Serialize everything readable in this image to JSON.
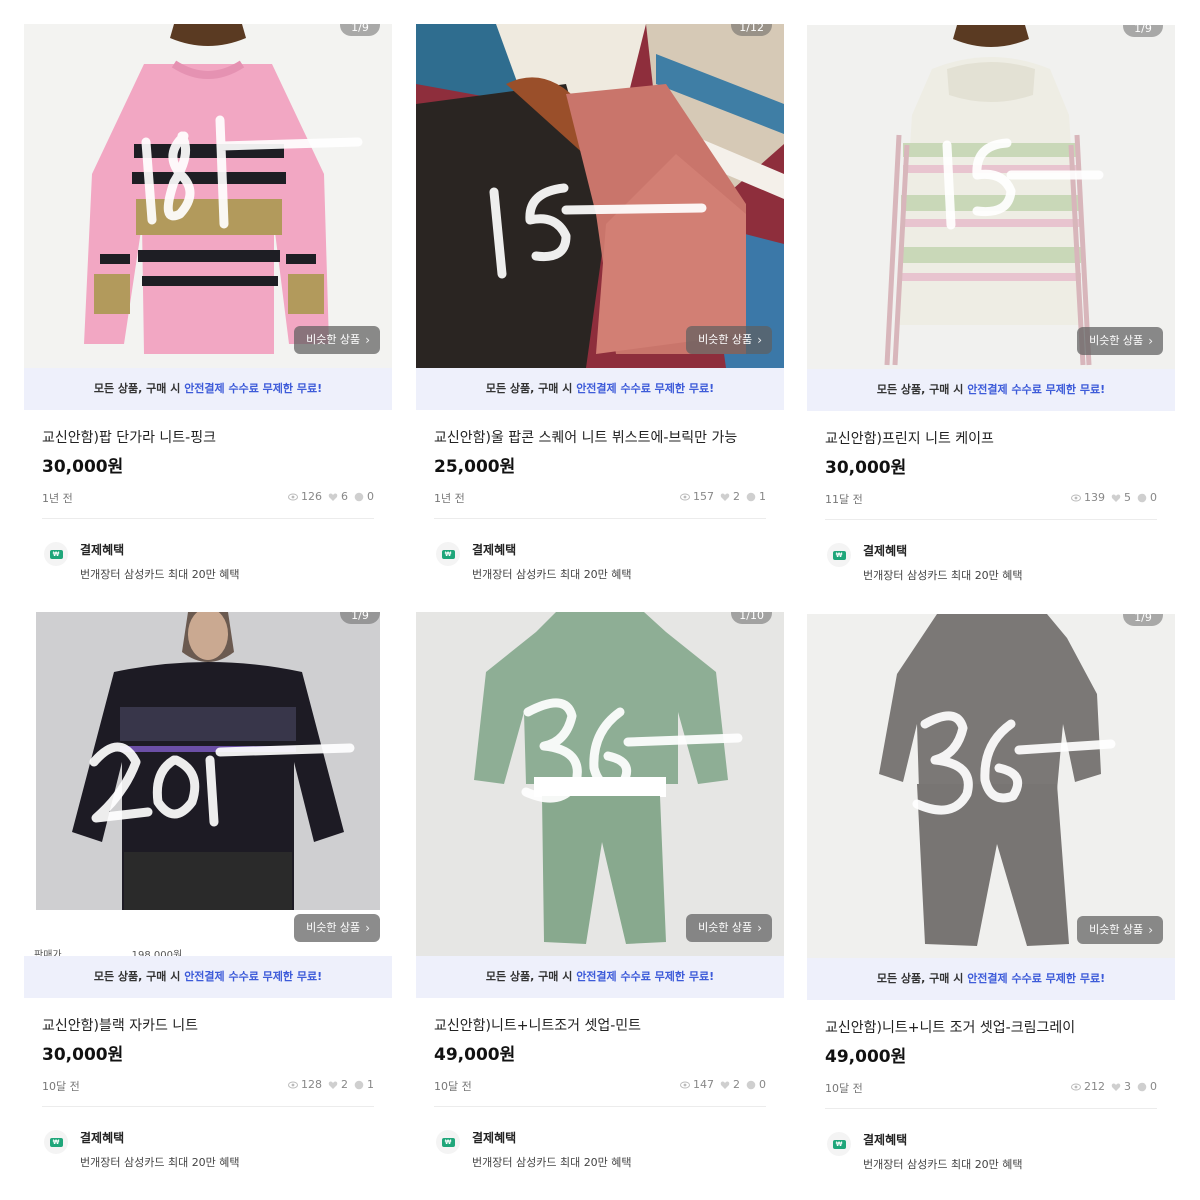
{
  "similar_label": "비슷한 상품",
  "promo": {
    "pre": "모든 상품, 구매 시 ",
    "highlight": "안전결제 수수료 무제한 무료!"
  },
  "benefit": {
    "title": "결제혜택",
    "subtitle": "번개장터 삼성카드 최대 20만 혜택"
  },
  "icons": {
    "views": "eye-icon",
    "likes": "heart-icon",
    "chats": "chat-icon",
    "benefit": "payment-card-icon",
    "more": "chevron-right-icon"
  },
  "colors": {
    "promo_bg": "#eef0fb",
    "promo_highlight": "#3d5bd9",
    "benefit_icon": "#1fa67a"
  },
  "listings": [
    {
      "image_count": "1/9",
      "scrawl_text": "18,-",
      "title": "교신안함)팝 단가라 니트-핑크",
      "price": "30,000원",
      "time": "1년 전",
      "views": "126",
      "likes": "6",
      "chats": "0"
    },
    {
      "image_count": "1/12",
      "scrawl_text": "15,-",
      "title": "교신안함)울 팝콘 스퀘어 니트 뷔스트에-브릭만 가능",
      "price": "25,000원",
      "time": "1년 전",
      "views": "157",
      "likes": "2",
      "chats": "1"
    },
    {
      "image_count": "1/9",
      "scrawl_text": "15,-",
      "title": "교신안함)프린지 니트 케이프",
      "price": "30,000원",
      "time": "11달 전",
      "views": "139",
      "likes": "5",
      "chats": "0"
    },
    {
      "image_count": "1/9",
      "scrawl_text": "20,-",
      "title": "교신안함)블랙 자카드 니트",
      "price": "30,000원",
      "time": "10달 전",
      "views": "128",
      "likes": "2",
      "chats": "1",
      "overlay_label": "판매가",
      "overlay_value": "198,000원"
    },
    {
      "image_count": "1/10",
      "scrawl_text": "36,-",
      "title": "교신안함)니트+니트조거 셋업-민트",
      "price": "49,000원",
      "time": "10달 전",
      "views": "147",
      "likes": "2",
      "chats": "0"
    },
    {
      "image_count": "1/9",
      "scrawl_text": "36,-",
      "title": "교신안함)니트+니트 조거 셋업-크림그레이",
      "price": "49,000원",
      "time": "10달 전",
      "views": "212",
      "likes": "3",
      "chats": "0"
    }
  ]
}
